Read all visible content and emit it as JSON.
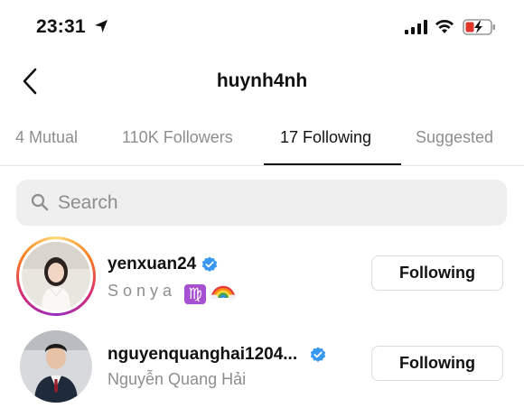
{
  "status_bar": {
    "time": "23:31"
  },
  "header": {
    "title": "huynh4nh"
  },
  "tabs": [
    {
      "label": "4 Mutual"
    },
    {
      "label": "110K Followers"
    },
    {
      "label": "17 Following"
    },
    {
      "label": "Suggested"
    }
  ],
  "search": {
    "placeholder": "Search",
    "value": ""
  },
  "following": [
    {
      "username": "yenxuan24",
      "full_name": "Sonya",
      "name_emojis": [
        "virgo",
        "rainbow"
      ],
      "virgo_glyph": "♍",
      "verified": true,
      "button_label": "Following"
    },
    {
      "username": "nguyenquanghai1204...",
      "full_name": "Nguyễn Quang Hải",
      "verified": true,
      "button_label": "Following"
    }
  ],
  "colors": {
    "verified_badge": "#3897f0",
    "muted_text": "#8e8e8e",
    "search_bg": "#efefef"
  }
}
